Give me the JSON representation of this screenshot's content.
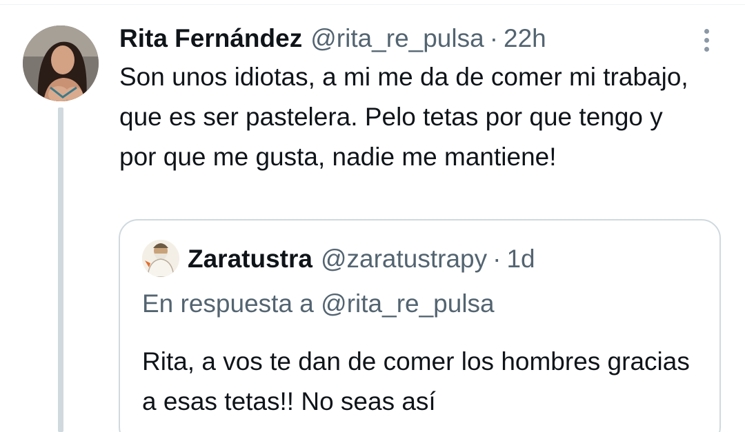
{
  "tweet": {
    "display_name": "Rita Fernández",
    "handle": "@rita_re_pulsa",
    "separator": "·",
    "time": "22h",
    "text": "Son unos idiotas, a mi me da de comer mi trabajo, que es ser pastelera. Pelo tetas por que tengo y por que me gusta, nadie me mantiene!",
    "avatar_icon": "user-avatar-photo",
    "more_icon": "more-vertical-icon"
  },
  "quoted_tweet": {
    "display_name": "Zaratustra",
    "handle": "@zaratustrapy",
    "separator": "·",
    "time": "1d",
    "reply_context": "En respuesta a @rita_re_pulsa",
    "text": "Rita, a vos te dan de comer los hombres gracias a esas tetas!! No seas así",
    "avatar_icon": "user-avatar-illustration"
  },
  "colors": {
    "primary_text": "#0f1419",
    "secondary_text": "#536471",
    "border": "#cfd9de",
    "thread_line": "#cfd9de"
  }
}
